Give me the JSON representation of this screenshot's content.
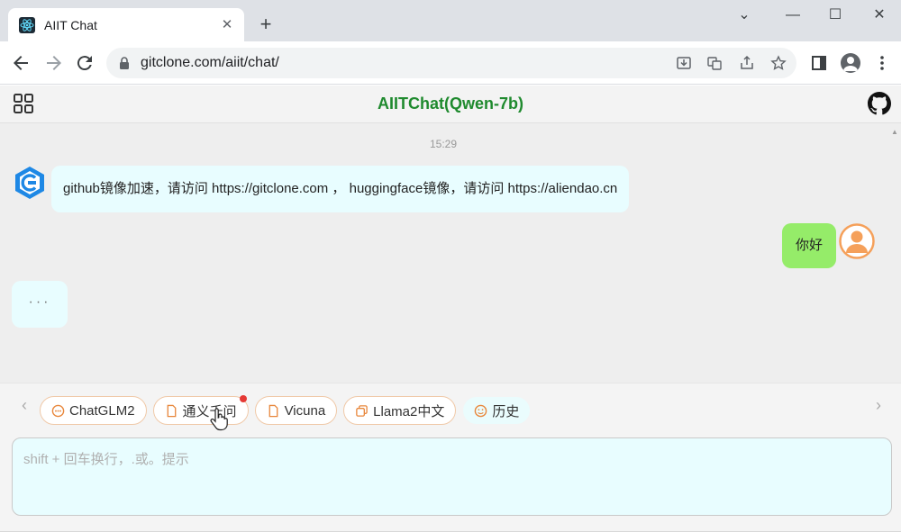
{
  "browser": {
    "tab_title": "AIIT Chat",
    "tab_close": "✕",
    "new_tab": "+",
    "window": {
      "minimize": "—",
      "restore": "☐",
      "close": "✕",
      "dropdown": "⌄"
    },
    "url": "gitclone.com/aiit/chat/"
  },
  "app": {
    "title": "AIITChat(Qwen-7b)"
  },
  "chat": {
    "timestamp": "15:29",
    "bot_message": "github镜像加速，请访问 https://gitclone.com ， huggingface镜像，请访问 https://aliendao.cn",
    "user_message": "你好",
    "typing": "···"
  },
  "chips": [
    {
      "label": "ChatGLM2",
      "icon": "chat-icon"
    },
    {
      "label": "通义千问",
      "icon": "document-icon"
    },
    {
      "label": "Vicuna",
      "icon": "document-icon"
    },
    {
      "label": "Llama2中文",
      "icon": "copy-icon"
    },
    {
      "label": "历史",
      "icon": "history-icon"
    }
  ],
  "nav": {
    "prev": "‹",
    "next": "›"
  },
  "input": {
    "placeholder": "shift + 回车换行，.或。提示",
    "value": ""
  },
  "colors": {
    "accent_title": "#1f8a2e",
    "bot_bubble": "#e8fdff",
    "user_bubble": "#95ec69",
    "chip_border": "#f0c9a8"
  }
}
